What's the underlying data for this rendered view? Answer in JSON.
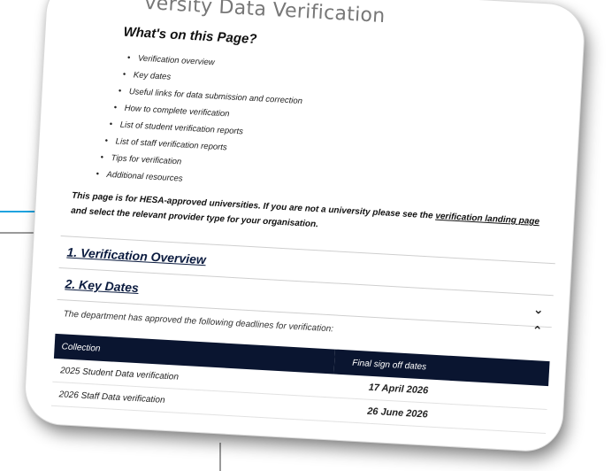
{
  "page": {
    "title": "versity Data Verification"
  },
  "toc": {
    "heading": "What's on this Page?",
    "items": [
      "Verification overview",
      "Key dates",
      "Useful links for data submission and correction",
      "How to complete verification",
      "List of student verification reports",
      "List of staff verification reports",
      "Tips for verification",
      "Additional resources"
    ]
  },
  "notice": {
    "text_before": "This page is for HESA-approved universities. If you are not a university please see the ",
    "link_text": "verification landing page",
    "text_after": " and select the relevant provider type for your organisation."
  },
  "accordion": [
    {
      "title": "1. Verification Overview",
      "chevron": "none"
    },
    {
      "title": "2. Key Dates",
      "chevron": "down"
    }
  ],
  "key_dates": {
    "chevron": "up",
    "intro": "The department has approved the following deadlines for verification:",
    "columns": [
      "Collection",
      "Final sign off dates"
    ],
    "rows": [
      [
        "2025 Student Data verification",
        "17 April 2026"
      ],
      [
        "2026 Staff Data verification",
        "26 June 2026"
      ]
    ]
  },
  "colors": {
    "table_header": "#0a1530",
    "accent_line": "#1fa3df",
    "link": "#0b1b3f"
  }
}
